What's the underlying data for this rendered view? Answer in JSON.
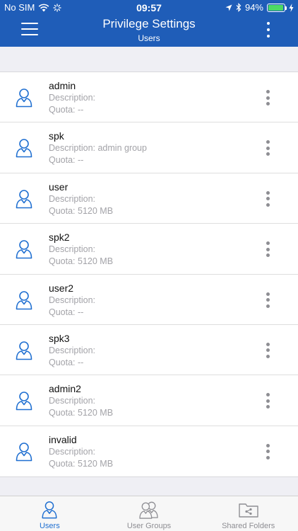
{
  "status": {
    "carrier": "No SIM",
    "time": "09:57",
    "battery": "94%",
    "battery_level": 0.94
  },
  "header": {
    "title": "Privilege Settings",
    "subtitle": "Users"
  },
  "users": [
    {
      "name": "admin",
      "description": "Description:",
      "quota": "Quota: --"
    },
    {
      "name": "spk",
      "description": "Description: admin group",
      "quota": "Quota: --"
    },
    {
      "name": "user",
      "description": "Description:",
      "quota": "Quota: 5120 MB"
    },
    {
      "name": "spk2",
      "description": "Description:",
      "quota": "Quota: 5120 MB"
    },
    {
      "name": "user2",
      "description": "Description:",
      "quota": "Quota: --"
    },
    {
      "name": "spk3",
      "description": "Description:",
      "quota": "Quota: --"
    },
    {
      "name": "admin2",
      "description": "Description:",
      "quota": "Quota: 5120 MB"
    },
    {
      "name": "invalid",
      "description": "Description:",
      "quota": "Quota: 5120 MB"
    }
  ],
  "tabs": [
    {
      "label": "Users",
      "icon": "user-icon",
      "active": true
    },
    {
      "label": "User Groups",
      "icon": "users-icon",
      "active": false
    },
    {
      "label": "Shared Folders",
      "icon": "shared-folder-icon",
      "active": false
    }
  ],
  "colors": {
    "header": "#1f5db8",
    "accent": "#1f6fd1",
    "inactive": "#8e8e93",
    "battery": "#4cd964"
  }
}
